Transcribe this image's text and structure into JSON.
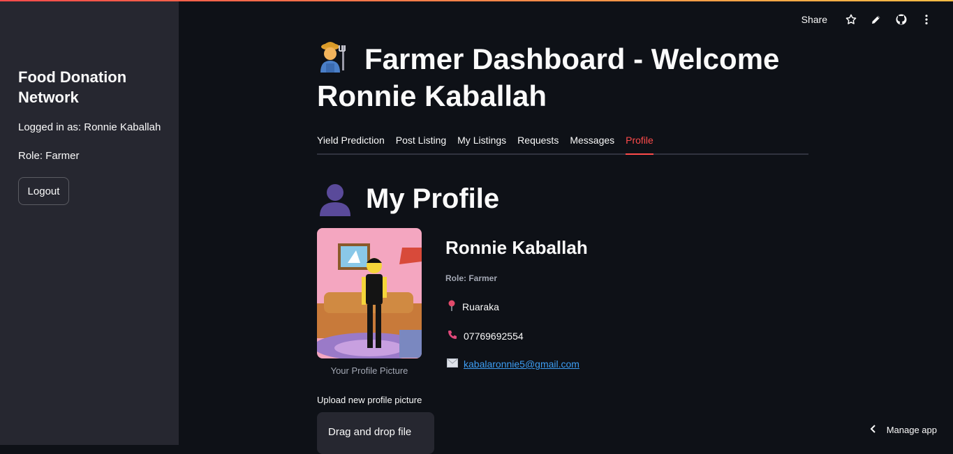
{
  "sidebar": {
    "title": "Food Donation Network",
    "logged_in": "Logged in as: Ronnie Kaballah",
    "role": "Role: Farmer",
    "logout_label": "Logout"
  },
  "toolbar": {
    "share_label": "Share",
    "icons": [
      "star-icon",
      "pencil-icon",
      "github-icon",
      "more-vertical-icon"
    ]
  },
  "header": {
    "title": "Farmer Dashboard - Welcome Ronnie Kaballah"
  },
  "tabs": [
    {
      "label": "Yield Prediction",
      "active": false
    },
    {
      "label": "Post Listing",
      "active": false
    },
    {
      "label": "My Listings",
      "active": false
    },
    {
      "label": "Requests",
      "active": false
    },
    {
      "label": "Messages",
      "active": false
    },
    {
      "label": "Profile",
      "active": true
    }
  ],
  "profile": {
    "heading": "My Profile",
    "name": "Ronnie Kaballah",
    "role": "Role: Farmer",
    "location": "Ruaraka",
    "phone": "07769692554",
    "email": "kabalaronnie5@gmail.com",
    "picture_caption": "Your Profile Picture"
  },
  "upload": {
    "label": "Upload new profile picture",
    "dropzone_text": "Drag and drop file"
  },
  "footer": {
    "manage_label": "Manage app"
  },
  "colors": {
    "accent": "#ff4b4b",
    "background": "#0e1117",
    "sidebar": "#262730",
    "link": "#3d9df3"
  }
}
